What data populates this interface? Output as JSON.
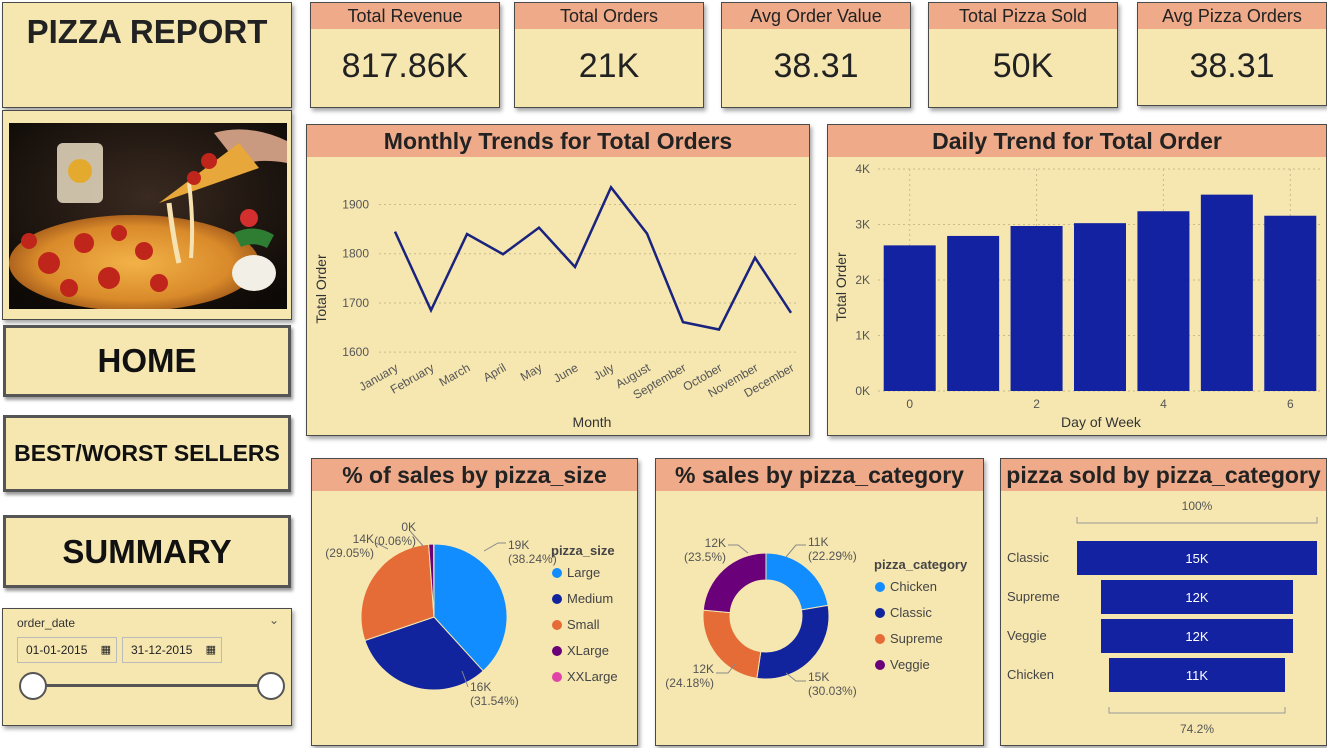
{
  "report_title": "PIZZA REPORT",
  "kpis": [
    {
      "label": "Total Revenue",
      "value": "817.86K"
    },
    {
      "label": "Total Orders",
      "value": "21K"
    },
    {
      "label": "Avg Order Value",
      "value": "38.31"
    },
    {
      "label": "Total Pizza Sold",
      "value": "50K"
    },
    {
      "label": "Avg Pizza Orders",
      "value": "38.31"
    }
  ],
  "nav": {
    "home": "HOME",
    "best_worst": "BEST/WORST SELLERS",
    "summary": "SUMMARY"
  },
  "slicer": {
    "label": "order_date",
    "start": "01-01-2015",
    "end": "31-12-2015"
  },
  "colors": {
    "card_bg": "#f6e7b1",
    "header_bg": "#eeaa89",
    "line": "#1a237e",
    "bar": "#1322a0",
    "large": "#118dff",
    "medium": "#12239e",
    "small": "#e66c37",
    "xlarge": "#6b007b",
    "xxlarge": "#e044a7"
  },
  "chart_data": [
    {
      "type": "line",
      "title": "Monthly Trends for Total Orders",
      "xlabel": "Month",
      "ylabel": "Total Order",
      "categories": [
        "January",
        "February",
        "March",
        "April",
        "May",
        "June",
        "July",
        "August",
        "September",
        "October",
        "November",
        "December"
      ],
      "values": [
        1845,
        1685,
        1840,
        1799,
        1853,
        1773,
        1935,
        1841,
        1661,
        1646,
        1792,
        1680
      ],
      "ylim": [
        1580,
        1960
      ],
      "yticks": [
        "1600",
        "1700",
        "1800",
        "1900"
      ],
      "grid": true
    },
    {
      "type": "bar",
      "title": "Daily Trend for Total Order",
      "xlabel": "Day of Week",
      "ylabel": "Total Order",
      "categories": [
        "0",
        "1",
        "2",
        "3",
        "4",
        "5",
        "6"
      ],
      "xticks": [
        "0",
        "2",
        "4",
        "6"
      ],
      "values": [
        2624,
        2794,
        2973,
        3024,
        3239,
        3538,
        3158
      ],
      "ylim": [
        0,
        4000
      ],
      "yticks": [
        "0K",
        "1K",
        "2K",
        "3K",
        "4K"
      ],
      "grid": true
    },
    {
      "type": "pie",
      "title": "% of sales by pizza_size",
      "legend_title": "pizza_size",
      "legend_position": "right",
      "slices": [
        {
          "name": "Large",
          "value": 38.24,
          "label": "19K",
          "pct": "(38.24%)"
        },
        {
          "name": "Medium",
          "value": 31.54,
          "label": "16K",
          "pct": "(31.54%)"
        },
        {
          "name": "Small",
          "value": 29.05,
          "label": "14K",
          "pct": "(29.05%)"
        },
        {
          "name": "XLarge",
          "value": 1.11,
          "label": "",
          "pct": ""
        },
        {
          "name": "XXLarge",
          "value": 0.06,
          "label": "0K",
          "pct": "(0.06%)"
        }
      ]
    },
    {
      "type": "pie",
      "title": "% sales by pizza_category",
      "legend_title": "pizza_category",
      "legend_position": "right",
      "slices": [
        {
          "name": "Chicken",
          "value": 22.29,
          "label": "11K",
          "pct": "(22.29%)"
        },
        {
          "name": "Classic",
          "value": 30.03,
          "label": "15K",
          "pct": "(30.03%)"
        },
        {
          "name": "Supreme",
          "value": 24.18,
          "label": "12K",
          "pct": "(24.18%)"
        },
        {
          "name": "Veggie",
          "value": 23.5,
          "label": "12K",
          "pct": "(23.5%)"
        }
      ]
    },
    {
      "type": "bar",
      "title": "pizza sold by pizza_category",
      "categories": [
        "Classic",
        "Supreme",
        "Veggie",
        "Chicken"
      ],
      "values": [
        15000,
        12000,
        12000,
        11000
      ],
      "labels": [
        "15K",
        "12K",
        "12K",
        "11K"
      ],
      "top_pct": "100%",
      "bottom_pct": "74.2%"
    }
  ]
}
